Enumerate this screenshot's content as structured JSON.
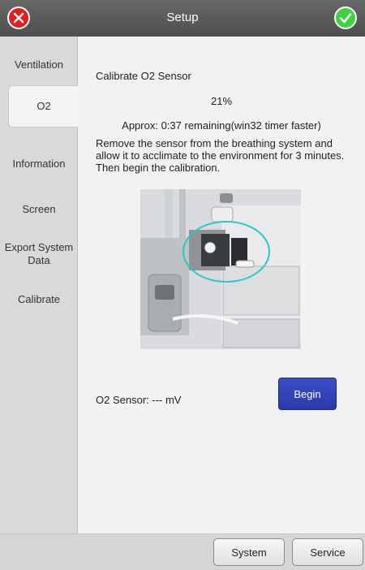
{
  "window": {
    "title": "Setup"
  },
  "sidebar": {
    "items": [
      {
        "label": "Ventilation"
      },
      {
        "label": "O2"
      },
      {
        "label": "Information"
      },
      {
        "label": "Screen"
      },
      {
        "label": "Export System Data"
      },
      {
        "label": "Calibrate"
      }
    ],
    "active_index": 1
  },
  "content": {
    "heading": "Calibrate O2 Sensor",
    "percent": "21%",
    "approx": "Approx: 0:37 remaining(win32 timer faster)",
    "instructions": "Remove the sensor from the breathing system and allow it to acclimate to the environment for 3 minutes. Then begin the calibration.",
    "sensor_readout": "O2 Sensor: --- mV",
    "begin_label": "Begin"
  },
  "footer": {
    "system_label": "System",
    "service_label": "Service"
  },
  "colors": {
    "accent_blue": "#2f40b5",
    "cancel_red": "#e02020",
    "ok_green": "#3fd13f",
    "highlight_cyan": "#2ac7c7"
  }
}
